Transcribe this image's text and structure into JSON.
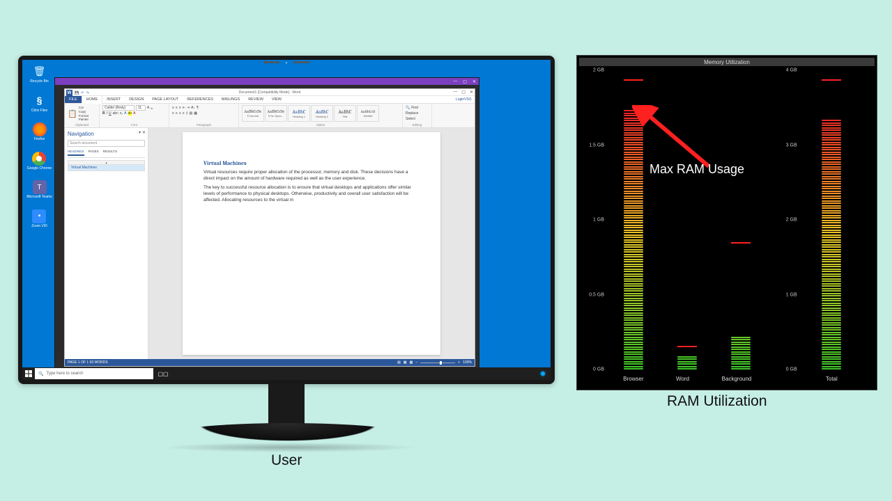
{
  "diagram": {
    "user_caption": "User",
    "ram_caption": "RAM Utilization"
  },
  "desktop": {
    "icons": [
      {
        "label": "Recycle Bin"
      },
      {
        "label": "Citrix Files"
      },
      {
        "label": "Firefox"
      },
      {
        "label": "Google Chrome"
      },
      {
        "label": "Microsoft Teams"
      },
      {
        "label": "Zoom VDI"
      }
    ]
  },
  "taskbar": {
    "search_placeholder": "Type here to search"
  },
  "word": {
    "title": "Document1 [Compatibility Mode] - Word",
    "user": "LoginVSI1",
    "tabs": {
      "file": "FILE",
      "home": "HOME",
      "insert": "INSERT",
      "design": "DESIGN",
      "pagelayout": "PAGE LAYOUT",
      "references": "REFERENCES",
      "mailings": "MAILINGS",
      "review": "REVIEW",
      "view": "VIEW"
    },
    "ribbon": {
      "clipboard": {
        "paste": "Paste",
        "cut": "Cut",
        "copy": "Copy",
        "painter": "Format Painter",
        "label": "Clipboard"
      },
      "font": {
        "name": "Calibri (Body)",
        "size": "11",
        "label": "Font"
      },
      "paragraph": {
        "label": "Paragraph"
      },
      "styles": {
        "normal": "¶ Normal",
        "nospac": "¶ No Spac...",
        "h1": "Heading 1",
        "h2": "Heading 2",
        "title": "Title",
        "subtitle": "Subtitle",
        "prev": "AaBbCcDc",
        "prevbig": "AaBbC",
        "label": "Styles"
      },
      "editing": {
        "find": "Find",
        "replace": "Replace",
        "select": "Select",
        "label": "Editing"
      }
    },
    "nav": {
      "title": "Navigation",
      "search_placeholder": "Search document",
      "tabs": {
        "headings": "HEADINGS",
        "pages": "PAGES",
        "results": "RESULTS"
      },
      "item": "Virtual Machines"
    },
    "doc": {
      "heading": "Virtual Machines",
      "p1": "Virtual resources require proper allocation of the processor, memory and disk. These decisions have a direct impact on the amount of hardware required as well as the user experience.",
      "p2": "The key to successful resource allocation is to ensure that virtual desktops and applications offer similar levels of performance to physical desktops. Otherwise, productivity and overall user satisfaction will be affected. Allocating resources to the virtual m"
    },
    "status": {
      "left": "PAGE 1 OF 1    63 WORDS",
      "zoom": "100%"
    }
  },
  "chart_data": {
    "title": "Memory Utilization",
    "annotation": "Max RAM Usage",
    "left": {
      "ylabels": [
        "2 GB",
        "1.5 GB",
        "1 GB",
        "0.5 GB",
        "0 GB"
      ],
      "ymax": 2.0,
      "bars": [
        {
          "name": "Browser",
          "value": 1.95,
          "marker": 1.95
        },
        {
          "name": "Word",
          "value": 0.1,
          "marker": 0.15
        },
        {
          "name": "Background",
          "value": 0.25,
          "marker": 0.85
        }
      ]
    },
    "right": {
      "ylabels": [
        "4 GB",
        "3 GB",
        "2 GB",
        "1 GB",
        "0 GB"
      ],
      "ymax": 4.0,
      "bars": [
        {
          "name": "Total",
          "value": 3.75,
          "marker": 3.9
        }
      ]
    }
  }
}
